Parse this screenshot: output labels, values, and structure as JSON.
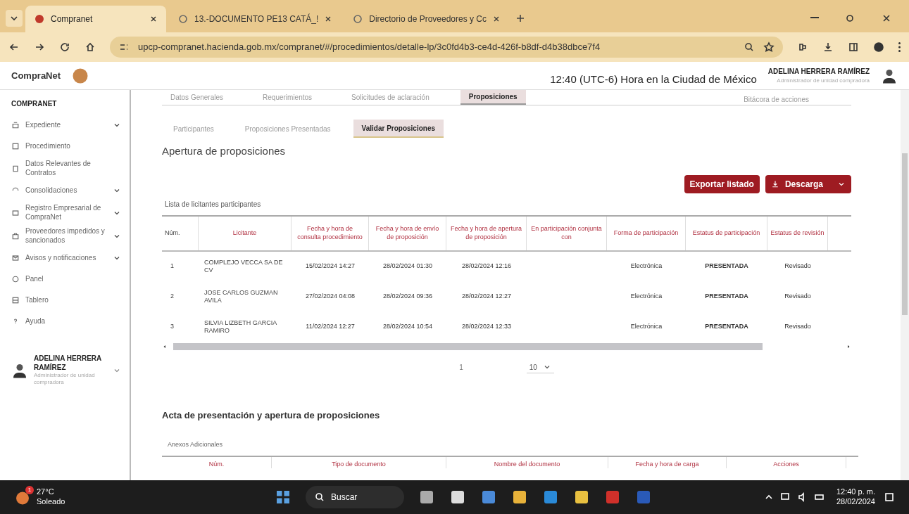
{
  "browser": {
    "tabs": [
      {
        "title": "Compranet",
        "selected": true
      },
      {
        "title": "13.-DOCUMENTO PE13 CATÁ_!",
        "selected": false
      },
      {
        "title": "Directorio de Proveedores y Cc",
        "selected": false
      }
    ],
    "url": "upcp-compranet.hacienda.gob.mx/compranet/#/procedimientos/detalle-lp/3c0fd4b3-ce4d-426f-b8df-d4b38dbce7f4"
  },
  "header": {
    "logo": "CompraNet",
    "time": "12:40 (UTC-6) Hora en la Ciudad de México",
    "user": "ADELINA HERRERA RAMÍREZ",
    "role": "Administrador de unidad compradora"
  },
  "sidebar": {
    "title": "COMPRANET",
    "items": [
      {
        "label": "Expediente",
        "expandable": true
      },
      {
        "label": "Procedimiento",
        "expandable": false
      },
      {
        "label": "Datos Relevantes de Contratos",
        "expandable": false
      },
      {
        "label": "Consolidaciones",
        "expandable": true
      },
      {
        "label": "Registro Empresarial de CompraNet",
        "expandable": true
      },
      {
        "label": "Proveedores impedidos y sancionados",
        "expandable": true
      },
      {
        "label": "Avisos y notificaciones",
        "expandable": true
      },
      {
        "label": "Panel",
        "expandable": false
      },
      {
        "label": "Tablero",
        "expandable": false
      },
      {
        "label": "Ayuda",
        "expandable": false
      }
    ],
    "user": {
      "name": "ADELINA HERRERA RAMÍREZ",
      "role": "Administrador de unidad compradora"
    }
  },
  "tabs": [
    {
      "label": "Datos Generales",
      "selected": false
    },
    {
      "label": "Requerimientos",
      "selected": false
    },
    {
      "label": "Solicitudes de aclaración",
      "selected": false
    },
    {
      "label": "Proposiciones",
      "selected": true
    }
  ],
  "log_link": "Bitácora de acciones",
  "subtabs": [
    {
      "label": "Participantes",
      "selected": false
    },
    {
      "label": "Proposiciones Presentadas",
      "selected": false
    },
    {
      "label": "Validar Proposiciones",
      "selected": true
    }
  ],
  "section_title": "Apertura de proposiciones",
  "buttons": {
    "export": "Exportar listado",
    "download": "Descarga"
  },
  "table": {
    "caption": "Lista de licitantes participantes",
    "columns": [
      "Núm.",
      "Licitante",
      "Fecha y hora de consulta procedimiento",
      "Fecha y hora de envío de proposición",
      "Fecha y hora de apertura de proposición",
      "En participación conjunta con",
      "Forma de participación",
      "Estatus de participación",
      "Estatus de revisión"
    ],
    "rows": [
      [
        "1",
        "COMPLEJO VECCA SA DE CV",
        "15/02/2024 14:27",
        "28/02/2024 01:30",
        "28/02/2024 12:16",
        "",
        "Electrónica",
        "PRESENTADA",
        "Revisado"
      ],
      [
        "2",
        "JOSE CARLOS GUZMAN AVILA",
        "27/02/2024 04:08",
        "28/02/2024 09:36",
        "28/02/2024 12:27",
        "",
        "Electrónica",
        "PRESENTADA",
        "Revisado"
      ],
      [
        "3",
        "SILVIA LIZBETH GARCIA RAMIRO",
        "11/02/2024 12:27",
        "28/02/2024 10:54",
        "28/02/2024 12:33",
        "",
        "Electrónica",
        "PRESENTADA",
        "Revisado"
      ]
    ]
  },
  "pagination": {
    "page": "1",
    "page_size": "10"
  },
  "acta": {
    "title": "Acta de presentación y apertura de proposiciones",
    "caption": "Anexos Adicionales",
    "columns": [
      "Núm.",
      "Tipo de documento",
      "Nombre del documento",
      "Fecha y hora de carga",
      "Acciones"
    ]
  },
  "taskbar": {
    "temperature": "27°C",
    "weather": "Soleado",
    "badge": "1",
    "search": "Buscar",
    "time": "12:40 p. m.",
    "date": "28/02/2024"
  }
}
